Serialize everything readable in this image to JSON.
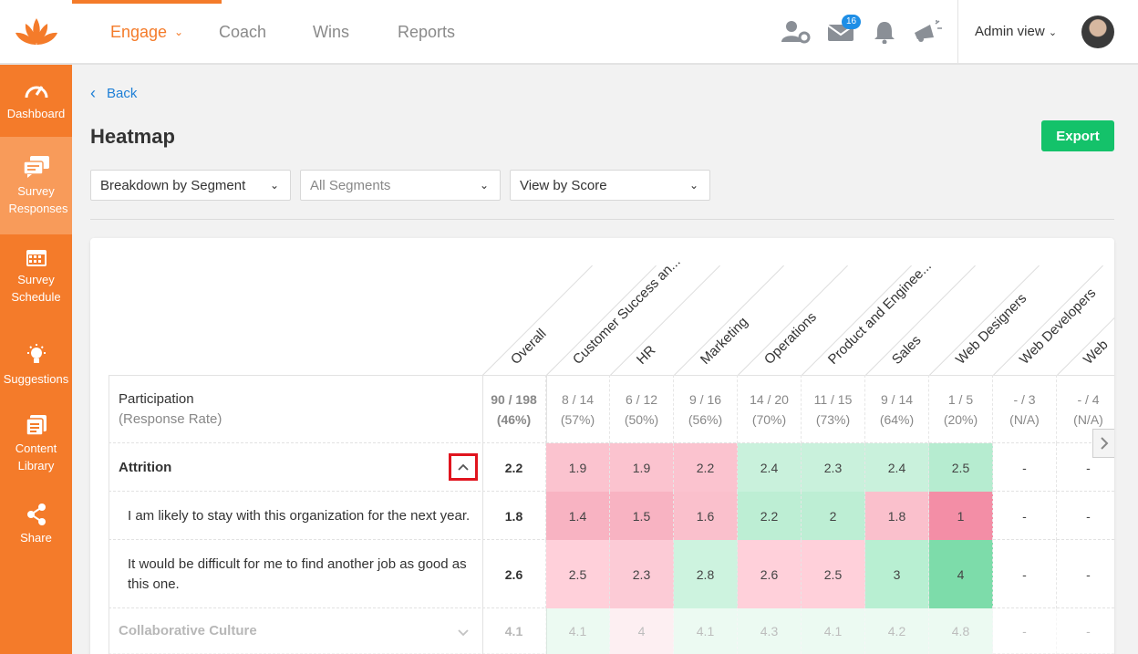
{
  "nav": {
    "items": [
      {
        "label": "Engage",
        "active": true
      },
      {
        "label": "Coach"
      },
      {
        "label": "Wins"
      },
      {
        "label": "Reports"
      }
    ],
    "mail_count": "16",
    "admin_label": "Admin view"
  },
  "sidebar": {
    "items": [
      {
        "label": "Dashboard",
        "icon": "gauge-icon"
      },
      {
        "label": "Survey Responses",
        "icon": "chat-icon",
        "active": true
      },
      {
        "label": "Survey Schedule",
        "icon": "calendar-icon"
      },
      {
        "label": "Suggestions",
        "icon": "lightbulb-icon"
      },
      {
        "label": "Content Library",
        "icon": "library-icon"
      },
      {
        "label": "Share",
        "icon": "share-icon"
      }
    ]
  },
  "page": {
    "back_label": "Back",
    "title": "Heatmap",
    "export_label": "Export",
    "filters": {
      "breakdown": "Breakdown by Segment",
      "segments": "All Segments",
      "view": "View by Score"
    }
  },
  "heatmap": {
    "columns": [
      "Overall",
      "Customer Success an...",
      "HR",
      "Marketing",
      "Operations",
      "Product and Enginee...",
      "Sales",
      "Web Designers",
      "Web Developers",
      "Web"
    ],
    "participation": {
      "label": "Participation",
      "sublabel": "(Response Rate)",
      "values": [
        {
          "count": "90 / 198",
          "rate": "(46%)"
        },
        {
          "count": "8 / 14",
          "rate": "(57%)"
        },
        {
          "count": "6 / 12",
          "rate": "(50%)"
        },
        {
          "count": "9 / 16",
          "rate": "(56%)"
        },
        {
          "count": "14 / 20",
          "rate": "(70%)"
        },
        {
          "count": "11 / 15",
          "rate": "(73%)"
        },
        {
          "count": "9 / 14",
          "rate": "(64%)"
        },
        {
          "count": "1 / 5",
          "rate": "(20%)"
        },
        {
          "count": "- / 3",
          "rate": "(N/A)"
        },
        {
          "count": "- / 4",
          "rate": "(N/A)"
        }
      ]
    },
    "rows": [
      {
        "label": "Attrition",
        "kind": "category",
        "values": [
          "2.2",
          "1.9",
          "1.9",
          "2.2",
          "2.4",
          "2.3",
          "2.4",
          "2.5",
          "-",
          "-"
        ]
      },
      {
        "label": "I am likely to stay with this organization for the next year.",
        "kind": "question",
        "values": [
          "1.8",
          "1.4",
          "1.5",
          "1.6",
          "2.2",
          "2",
          "1.8",
          "1",
          "-",
          "-"
        ]
      },
      {
        "label": "It would be difficult for me to find another job as good as this one.",
        "kind": "question",
        "values": [
          "2.6",
          "2.5",
          "2.3",
          "2.8",
          "2.6",
          "2.5",
          "3",
          "4",
          "-",
          "-"
        ]
      },
      {
        "label": "Collaborative Culture",
        "kind": "category-collapsed",
        "values": [
          "4.1",
          "4.1",
          "4",
          "4.1",
          "4.3",
          "4.1",
          "4.2",
          "4.8",
          "-",
          "-"
        ]
      }
    ]
  },
  "colors": {
    "brand_orange": "#f47b2a",
    "export_green": "#14c26a",
    "link_blue": "#1e7fd6",
    "low_score": "#f7a6b8",
    "high_score": "#7ddcaa"
  }
}
